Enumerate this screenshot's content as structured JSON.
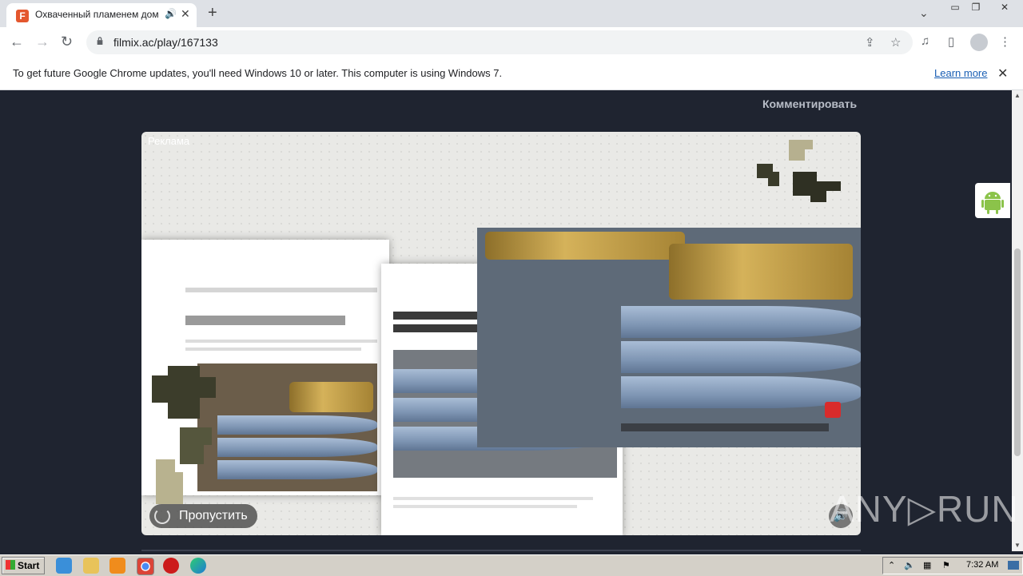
{
  "browser": {
    "tab_title": "Охваченный пламенем дом Ме",
    "url": "filmix.ac/play/167133",
    "new_tab_label": "+",
    "window_controls": [
      "minimize-icon",
      "restore-icon",
      "close-icon"
    ]
  },
  "infobar": {
    "message": "To get future Google Chrome updates, you'll need Windows 10 or later. This computer is using Windows 7.",
    "link": "Learn more"
  },
  "page": {
    "comment_link": "Комментировать",
    "ad_label": "Реклама",
    "skip_label": "Пропустить",
    "watermark": "ANY▷RUN"
  },
  "taskbar": {
    "start_label": "Start",
    "clock": "7:32 AM",
    "apps": [
      "ie-icon",
      "explorer-icon",
      "media-player-icon",
      "chrome-icon",
      "opera-icon",
      "edge-icon"
    ]
  }
}
